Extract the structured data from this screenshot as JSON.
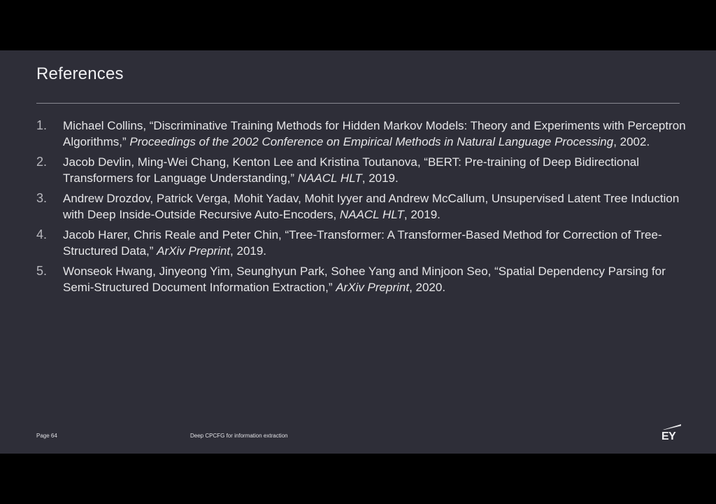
{
  "slide": {
    "title": "References",
    "references": [
      {
        "number": "1.",
        "text": "Michael Collins, “Discriminative Training Methods for Hidden Markov Models: Theory and Experiments with Perceptron Algorithms,” ",
        "venue": "Proceedings of the 2002 Conference on Empirical Methods in Natural Language Processing",
        "year": ", 2002."
      },
      {
        "number": "2.",
        "text": "Jacob Devlin, Ming-Wei Chang, Kenton Lee and Kristina Toutanova, “BERT: Pre-training of Deep Bidirectional Transformers for Language Understanding,” ",
        "venue": "NAACL HLT",
        "year": ", 2019."
      },
      {
        "number": "3.",
        "text": "Andrew Drozdov, Patrick Verga, Mohit Yadav, Mohit Iyyer and Andrew McCallum,  Unsupervised Latent Tree Induction with Deep Inside-Outside Recursive Auto-Encoders,  ",
        "venue": "NAACL HLT",
        "year": ", 2019."
      },
      {
        "number": "4.",
        "text": "Jacob Harer, Chris Reale and Peter Chin, “Tree-Transformer: A Transformer-Based Method for Correction of Tree-Structured Data,” ",
        "venue": "ArXiv Preprint",
        "year": ", 2019."
      },
      {
        "number": "5.",
        "text": "Wonseok Hwang, Jinyeong Yim, Seunghyun Park, Sohee Yang and Minjoon Seo, “Spatial Dependency Parsing for Semi-Structured Document Information Extraction,” ",
        "venue": "ArXiv Preprint",
        "year": ", 2020."
      }
    ],
    "footer": {
      "page": "Page 64",
      "deck_title": "Deep CPCFG for information extraction",
      "logo": "EY"
    }
  },
  "colors": {
    "slide_background": "#2e2e38",
    "text": "#e6e6e8",
    "letterbox": "#000000"
  }
}
